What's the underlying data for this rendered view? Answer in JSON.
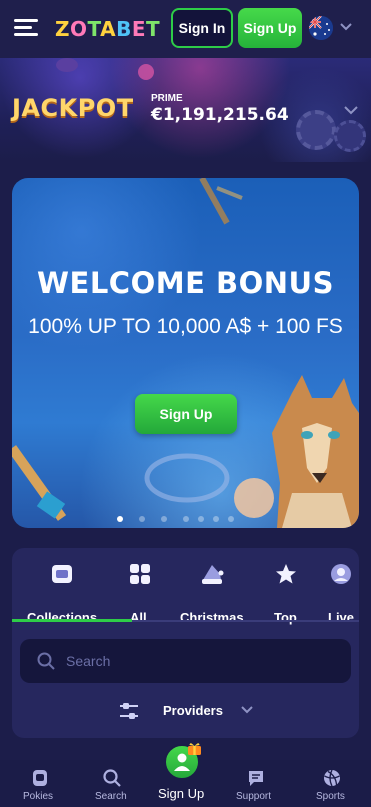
{
  "header": {
    "logo_text": "ZOTABET",
    "signin_label": "Sign In",
    "signup_label": "Sign Up",
    "language_flag": "australia-flag-icon",
    "colors": {
      "accent_green": "#2ecc48",
      "header_bg": "#1f1f4c"
    }
  },
  "jackpot": {
    "title": "JACKPOT",
    "label": "PRIME",
    "amount": "€1,191,215.64"
  },
  "banner": {
    "title": "WELCOME BONUS",
    "subtitle": "100% UP TO 10,000 A$ + 100 FS",
    "button_label": "Sign Up",
    "slide_count": 7,
    "active_slide": 1
  },
  "categories": {
    "items": [
      {
        "label": "Collections",
        "icon": "collections-icon",
        "active": true
      },
      {
        "label": "All",
        "icon": "grid-icon",
        "active": false
      },
      {
        "label": "Christmas",
        "icon": "santa-hat-icon",
        "active": false
      },
      {
        "label": "Top",
        "icon": "star-icon",
        "active": false
      },
      {
        "label": "Live",
        "icon": "live-dealer-icon",
        "active": false
      }
    ]
  },
  "search": {
    "placeholder": "Search"
  },
  "providers": {
    "label": "Providers"
  },
  "bottom_nav": {
    "items": [
      {
        "label": "Pokies",
        "icon": "pokies-icon"
      },
      {
        "label": "Search",
        "icon": "search-icon"
      },
      {
        "label": "Sign Up",
        "icon": "user-icon"
      },
      {
        "label": "Support",
        "icon": "chat-icon"
      },
      {
        "label": "Sports",
        "icon": "ball-icon"
      }
    ]
  }
}
